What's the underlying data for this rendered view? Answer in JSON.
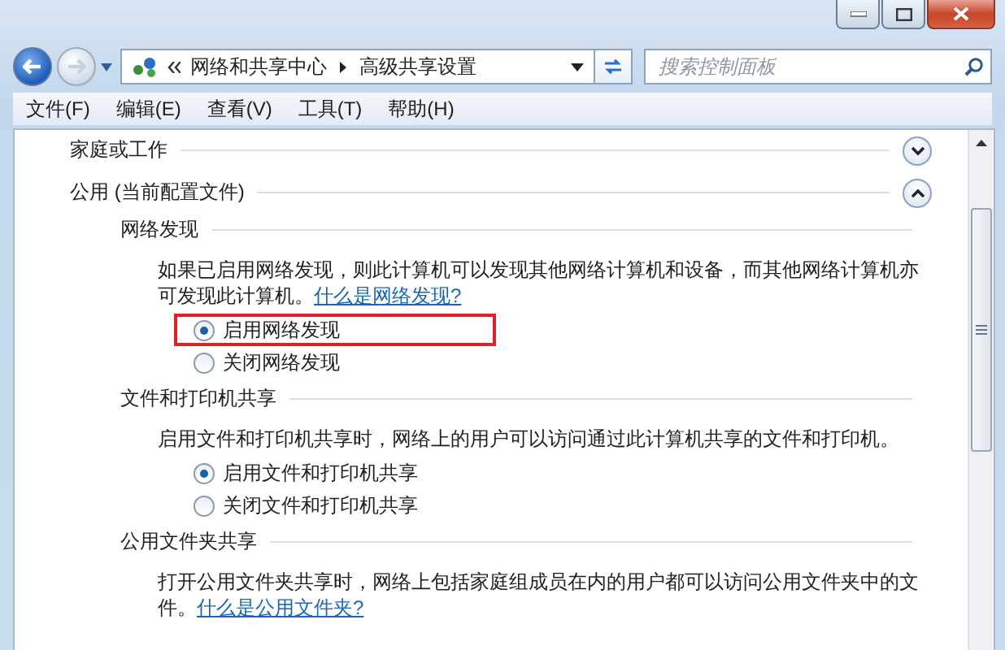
{
  "address_bar": {
    "breadcrumb": [
      "网络和共享中心",
      "高级共享设置"
    ]
  },
  "search": {
    "placeholder": "搜索控制面板"
  },
  "menu": [
    "文件(F)",
    "编辑(E)",
    "查看(V)",
    "工具(T)",
    "帮助(H)"
  ],
  "sections": [
    {
      "title": "家庭或工作",
      "expanded": false
    },
    {
      "title": "公用 (当前配置文件)",
      "expanded": true,
      "groups": [
        {
          "title": "网络发现",
          "description": "如果已启用网络发现，则此计算机可以发现其他网络计算机和设备，而其他网络计算机亦可发现此计算机。",
          "link": "什么是网络发现?",
          "options": [
            {
              "label": "启用网络发现",
              "selected": true,
              "highlighted": true
            },
            {
              "label": "关闭网络发现",
              "selected": false,
              "highlighted": false
            }
          ]
        },
        {
          "title": "文件和打印机共享",
          "description": "启用文件和打印机共享时，网络上的用户可以访问通过此计算机共享的文件和打印机。",
          "options": [
            {
              "label": "启用文件和打印机共享",
              "selected": true,
              "highlighted": false
            },
            {
              "label": "关闭文件和打印机共享",
              "selected": false,
              "highlighted": false
            }
          ]
        },
        {
          "title": "公用文件夹共享",
          "description": "打开公用文件夹共享时，网络上包括家庭组成员在内的用户都可以访问公用文件夹中的文件。",
          "link": "什么是公用文件夹?"
        }
      ]
    }
  ]
}
